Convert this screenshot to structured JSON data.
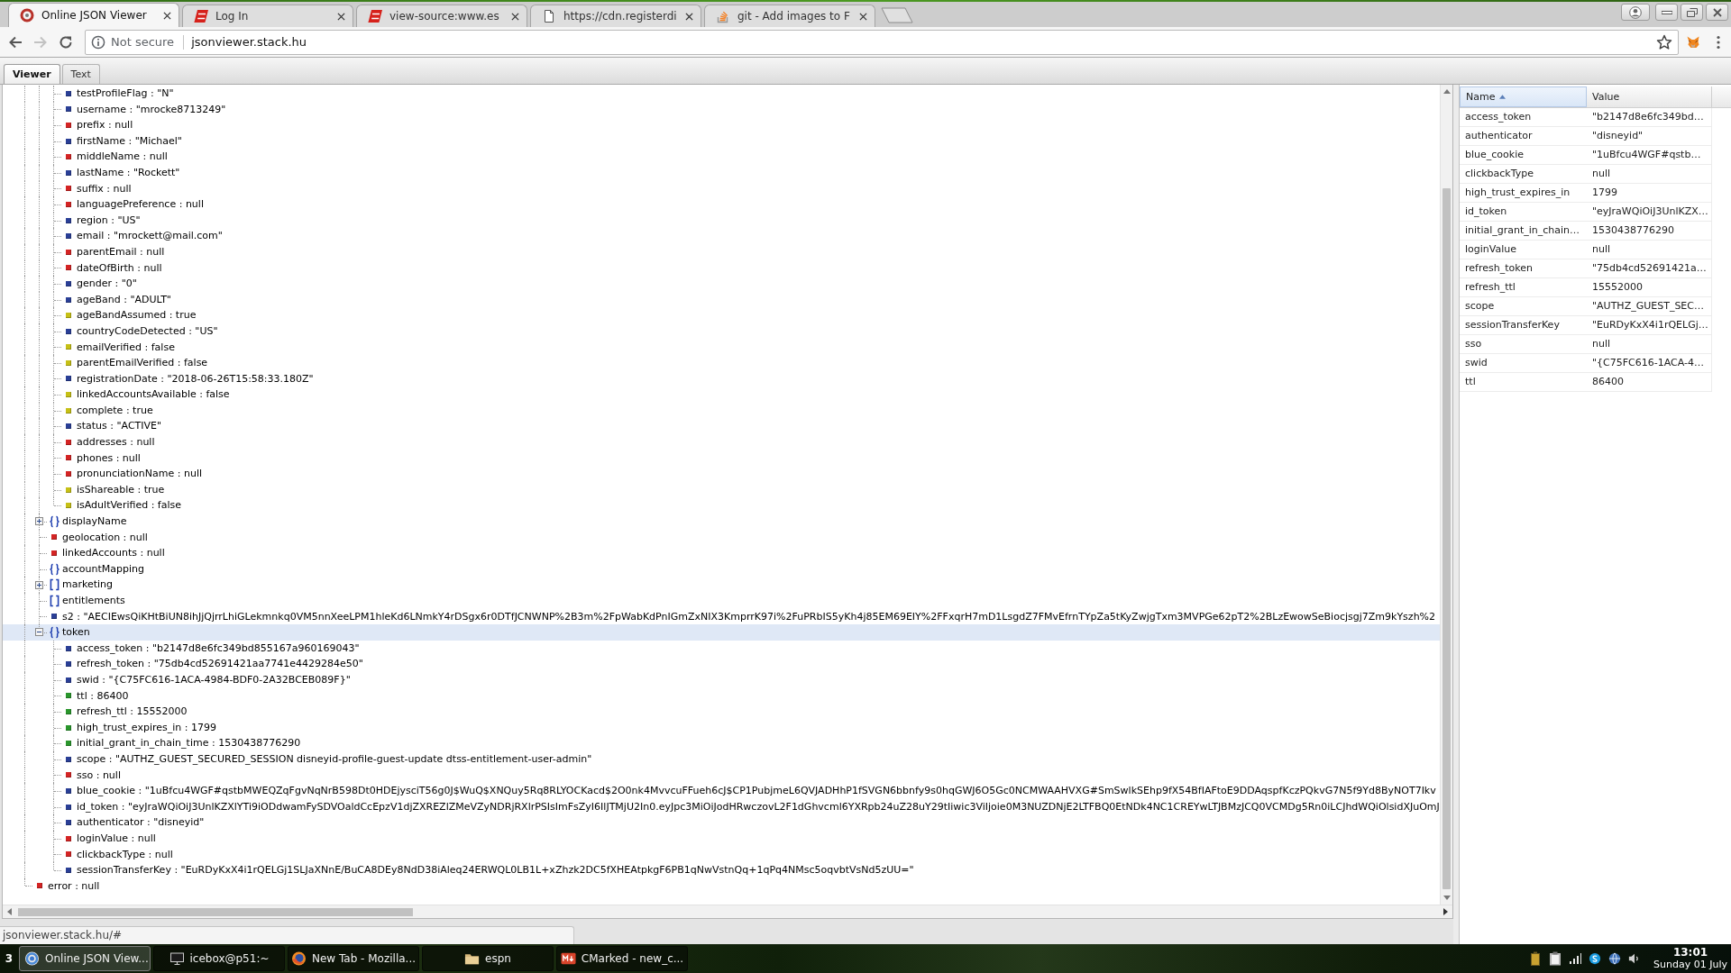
{
  "browser": {
    "tabs": [
      {
        "title": "Online JSON Viewer",
        "kind": "ring",
        "selected": true
      },
      {
        "title": "Log In",
        "kind": "e-logo",
        "selected": false
      },
      {
        "title": "view-source:www.es",
        "kind": "e-logo",
        "selected": false
      },
      {
        "title": "https://cdn.registerdi",
        "kind": "page",
        "selected": false
      },
      {
        "title": "git - Add images to F",
        "kind": "stack",
        "selected": false
      }
    ],
    "navigation": {
      "back": {
        "disabled": false
      },
      "forward": {
        "disabled": true
      }
    },
    "address": {
      "security": "Not secure",
      "url": "jsonviewer.stack.hu"
    }
  },
  "viewer": {
    "tabs": [
      {
        "label": "Viewer",
        "selected": true
      },
      {
        "label": "Text",
        "selected": false
      }
    ],
    "tree": [
      {
        "children": [
          {
            "children": [
              {
                "text": "testProfileFlag : \"N\"",
                "kind": "string",
                "selected": false
              },
              {
                "text": "username : \"mrocke8713249\"",
                "kind": "string",
                "selected": false
              },
              {
                "text": "prefix : null",
                "kind": "null",
                "selected": false
              },
              {
                "text": "firstName : \"Michael\"",
                "kind": "string",
                "selected": false
              },
              {
                "text": "middleName : null",
                "kind": "null",
                "selected": false
              },
              {
                "text": "lastName : \"Rockett\"",
                "kind": "string",
                "selected": false
              },
              {
                "text": "suffix : null",
                "kind": "null",
                "selected": false
              },
              {
                "text": "languagePreference : null",
                "kind": "null",
                "selected": false
              },
              {
                "text": "region : \"US\"",
                "kind": "string",
                "selected": false
              },
              {
                "text": "email : \"mrockett@mail.com\"",
                "kind": "string",
                "selected": false
              },
              {
                "text": "parentEmail : null",
                "kind": "null",
                "selected": false
              },
              {
                "text": "dateOfBirth : null",
                "kind": "null",
                "selected": false
              },
              {
                "text": "gender : \"0\"",
                "kind": "string",
                "selected": false
              },
              {
                "text": "ageBand : \"ADULT\"",
                "kind": "string",
                "selected": false
              },
              {
                "text": "ageBandAssumed : true",
                "kind": "boolean",
                "selected": false
              },
              {
                "text": "countryCodeDetected : \"US\"",
                "kind": "string",
                "selected": false
              },
              {
                "text": "emailVerified : false",
                "kind": "boolean",
                "selected": false
              },
              {
                "text": "parentEmailVerified : false",
                "kind": "boolean",
                "selected": false
              },
              {
                "text": "registrationDate : \"2018-06-26T15:58:33.180Z\"",
                "kind": "string",
                "selected": false
              },
              {
                "text": "linkedAccountsAvailable : false",
                "kind": "boolean",
                "selected": false
              },
              {
                "text": "complete : true",
                "kind": "boolean",
                "selected": false
              },
              {
                "text": "status : \"ACTIVE\"",
                "kind": "string",
                "selected": false
              },
              {
                "text": "addresses : null",
                "kind": "null",
                "selected": false
              },
              {
                "text": "phones : null",
                "kind": "null",
                "selected": false
              },
              {
                "text": "pronunciationName : null",
                "kind": "null",
                "selected": false
              },
              {
                "text": "isShareable : true",
                "kind": "boolean",
                "selected": false
              },
              {
                "text": "isAdultVerified : false",
                "kind": "boolean",
                "selected": false
              }
            ]
          },
          {
            "text": "displayName",
            "kind": "object",
            "expanded": false,
            "selected": false
          },
          {
            "text": "geolocation : null",
            "kind": "null",
            "selected": false
          },
          {
            "text": "linkedAccounts : null",
            "kind": "null",
            "selected": false
          },
          {
            "text": "accountMapping",
            "kind": "object",
            "selected": false
          },
          {
            "text": "marketing",
            "kind": "array",
            "expanded": false,
            "selected": false
          },
          {
            "text": "entitlements",
            "kind": "array",
            "selected": false
          },
          {
            "text": "s2 : \"AECIEwsQiKHtBiUN8ihJjQjrrLhiGLekmnkq0VM5nnXeeLPM1hleKd6LNmkY4rDSgx6r0DTfJCNWNP%2B3m%2FpWabKdPnIGmZxNIX3KmprrK97i%2FuPRbIS5yKh4j85EM69EIY%2FFxqrH7mD1LsgdZ7FMvEfrnTYpZa5tKyZwjgTxm3MVPGe62pT2%2BLzEwowSeBiocjsgj7Zm9kYszh%2",
            "kind": "string",
            "selected": false
          },
          {
            "text": "token",
            "kind": "object",
            "expanded": true,
            "selected": true,
            "children": [
              {
                "text": "access_token : \"b2147d8e6fc349bd855167a960169043\"",
                "kind": "string",
                "selected": false
              },
              {
                "text": "refresh_token : \"75db4cd52691421aa7741e4429284e50\"",
                "kind": "string",
                "selected": false
              },
              {
                "text": "swid : \"{C75FC616-1ACA-4984-BDF0-2A32BCEB089F}\"",
                "kind": "string",
                "selected": false
              },
              {
                "text": "ttl : 86400",
                "kind": "number",
                "selected": false
              },
              {
                "text": "refresh_ttl : 15552000",
                "kind": "number",
                "selected": false
              },
              {
                "text": "high_trust_expires_in : 1799",
                "kind": "number",
                "selected": false
              },
              {
                "text": "initial_grant_in_chain_time : 1530438776290",
                "kind": "number",
                "selected": false
              },
              {
                "text": "scope : \"AUTHZ_GUEST_SECURED_SESSION disneyid-profile-guest-update dtss-entitlement-user-admin\"",
                "kind": "string",
                "selected": false
              },
              {
                "text": "sso : null",
                "kind": "null",
                "selected": false
              },
              {
                "text": "blue_cookie : \"1uBfcu4WGF#qstbMWEQZqFgvNqNrB598Dt0HDEjysciT56g0J$WuQ$XNQuy5Rq8RLYOCKacd$2O0nk4MvvcuFFueh6cJ$CP1PubjmeL6QVJADHhP1fSVGN6bbnfy9s0hqGWJ6O5Gc0NCMWAAHVXG#SmSwlkSEhp9fX54BfIAFtoE9DDAqspfKczPQkvG7N5f9Yd8ByNOT7Ikv",
                "kind": "string",
                "selected": false
              },
              {
                "text": "id_token : \"eyJraWQiOiJ3UnlKZXlYTi9iODdwamFySDVOaldCcEpzV1djZXREZlZMeVZyNDRjRXlrPSIsImFsZyI6IlJTMjU2In0.eyJpc3MiOiJodHRwczovL2F1dGhvcml6YXRpb24uZ28uY29tIiwic3ViIjoie0M3NUZDNjE2LTFBQ0EtNDk4NC1CREYwLTJBMzJCQ0VCMDg5Rn0iLCJhdWQiOlsidXJuOmJ",
                "kind": "string",
                "selected": false
              },
              {
                "text": "authenticator : \"disneyid\"",
                "kind": "string",
                "selected": false
              },
              {
                "text": "loginValue : null",
                "kind": "null",
                "selected": false
              },
              {
                "text": "clickbackType : null",
                "kind": "null",
                "selected": false
              },
              {
                "text": "sessionTransferKey : \"EuRDyKxX4i1rQELGj1SLJaXNnE/BuCA8DEy8NdD38iAleq24ERWQL0LB1L+xZhzk2DC5fXHEAtpkgF6PB1qNwVstnQq+1qPq4NMsc5oqvbtVsNd5zUU=\"",
                "kind": "string",
                "selected": false
              }
            ]
          }
        ]
      },
      {
        "text": "error : null",
        "kind": "null",
        "selected": false
      }
    ],
    "properties": {
      "columns": [
        {
          "label": "Name",
          "sorted": true
        },
        {
          "label": "Value",
          "sorted": false
        }
      ],
      "rows": [
        {
          "name": "access_token",
          "value": "\"b2147d8e6fc349bd…"
        },
        {
          "name": "authenticator",
          "value": "\"disneyid\""
        },
        {
          "name": "blue_cookie",
          "value": "\"1uBfcu4WGF#qstb…"
        },
        {
          "name": "clickbackType",
          "value": "null"
        },
        {
          "name": "high_trust_expires_in",
          "value": "1799"
        },
        {
          "name": "id_token",
          "value": "\"eyJraWQiOiJ3UnlKZX…"
        },
        {
          "name": "initial_grant_in_chain…",
          "value": "1530438776290"
        },
        {
          "name": "loginValue",
          "value": "null"
        },
        {
          "name": "refresh_token",
          "value": "\"75db4cd52691421a…"
        },
        {
          "name": "refresh_ttl",
          "value": "15552000"
        },
        {
          "name": "scope",
          "value": "\"AUTHZ_GUEST_SEC…"
        },
        {
          "name": "sessionTransferKey",
          "value": "\"EuRDyKxX4i1rQELGj…"
        },
        {
          "name": "sso",
          "value": "null"
        },
        {
          "name": "swid",
          "value": "\"{C75FC616-1ACA-4…"
        },
        {
          "name": "ttl",
          "value": "86400"
        }
      ]
    }
  },
  "status_url": "jsonviewer.stack.hu/#",
  "taskbar": {
    "workspace": "3",
    "items": [
      {
        "label": "Online JSON View...",
        "kind": "browser",
        "selected": true
      },
      {
        "label": "icebox@p51:~",
        "kind": "terminal",
        "selected": false
      },
      {
        "label": "New Tab - Mozilla...",
        "kind": "globe",
        "selected": false
      },
      {
        "label": "espn",
        "kind": "folder",
        "selected": false
      },
      {
        "label": "CMarked - new_c...",
        "kind": "markdown",
        "selected": false
      }
    ],
    "clock": {
      "time": "13:01",
      "date": "Sunday 01 July"
    }
  }
}
